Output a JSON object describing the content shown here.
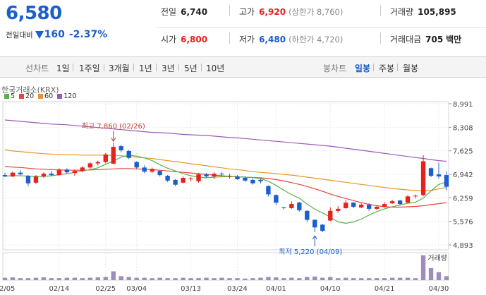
{
  "quote": {
    "price": "6,580",
    "change_label": "전일대비",
    "change_amount": "160",
    "change_pct": "-2.37%",
    "down_color": "#1b5ecd",
    "up_color": "#e8211d"
  },
  "summary": {
    "prev_close_label": "전일",
    "prev_close": "6,740",
    "high_label": "고가",
    "high": "6,920",
    "upper_limit": "(상한가 8,760)",
    "volume_label": "거래량",
    "volume": "105,895",
    "open_label": "시가",
    "open": "6,800",
    "low_label": "저가",
    "low": "6,480",
    "lower_limit": "(하한가 4,720)",
    "amount_label": "거래대금",
    "amount": "705",
    "amount_unit": "백만"
  },
  "toolbar": {
    "line_chart_label": "선차트",
    "periods": [
      "1일",
      "1주일",
      "3개월",
      "1년",
      "3년",
      "5년",
      "10년"
    ],
    "candle_label": "봉차트",
    "candle_periods": [
      "일봉",
      "주봉",
      "월봉"
    ],
    "active_candle": "일봉"
  },
  "exchange_label": "한국거래소(KRX)",
  "legend": [
    {
      "label": "5",
      "color": "#56b348"
    },
    {
      "label": "20",
      "color": "#e8443a"
    },
    {
      "label": "60",
      "color": "#e8962a"
    },
    {
      "label": "120",
      "color": "#9b59b6"
    }
  ],
  "chart_data": {
    "type": "candlestick",
    "y_ticks": [
      "8,991",
      "8,308",
      "7,625",
      "6,942",
      "6,259",
      "5,576",
      "4,893"
    ],
    "y_tick_values": [
      8991,
      8308,
      7625,
      6942,
      6259,
      5576,
      4893
    ],
    "ylim": [
      4893,
      8991
    ],
    "x_ticks": [
      "02/05",
      "02/14",
      "02/25",
      "03/04",
      "03/13",
      "03/24",
      "04/01",
      "04/10",
      "04/21",
      "04/30"
    ],
    "x_tick_index": [
      0,
      7,
      13,
      17,
      24,
      30,
      35,
      42,
      49,
      56
    ],
    "high_annotation": {
      "text": "최고 7,860 (02/26)",
      "index": 14,
      "value": 7860
    },
    "low_annotation": {
      "text": "최저 5,220 (04/09)",
      "index": 40,
      "value": 5220
    },
    "volume_label": "거래량",
    "candles": [
      [
        6920,
        6980,
        6860,
        6880
      ],
      [
        6880,
        7020,
        6860,
        6990
      ],
      [
        6990,
        7060,
        6920,
        6940
      ],
      [
        6900,
        6920,
        6600,
        6680
      ],
      [
        6700,
        6920,
        6660,
        6880
      ],
      [
        6880,
        7000,
        6840,
        6960
      ],
      [
        6960,
        7040,
        6880,
        6920
      ],
      [
        6920,
        7120,
        6900,
        7080
      ],
      [
        7080,
        7120,
        6960,
        7000
      ],
      [
        6980,
        7080,
        6900,
        7040
      ],
      [
        7040,
        7180,
        7000,
        7140
      ],
      [
        7140,
        7300,
        7100,
        7260
      ],
      [
        7260,
        7340,
        7200,
        7300
      ],
      [
        7300,
        7560,
        7260,
        7520
      ],
      [
        7250,
        7860,
        7250,
        7740
      ],
      [
        7760,
        7800,
        7580,
        7640
      ],
      [
        7620,
        7650,
        7380,
        7420
      ],
      [
        7300,
        7320,
        7100,
        7140
      ],
      [
        7140,
        7200,
        6980,
        7020
      ],
      [
        7020,
        7140,
        6980,
        7100
      ],
      [
        7040,
        7060,
        6880,
        6920
      ],
      [
        6900,
        6920,
        6720,
        6760
      ],
      [
        6780,
        6800,
        6600,
        6640
      ],
      [
        6700,
        6880,
        6680,
        6840
      ],
      [
        6800,
        6860,
        6740,
        6820
      ],
      [
        6740,
        6980,
        6700,
        6940
      ],
      [
        6940,
        6980,
        6840,
        6880
      ],
      [
        6880,
        7000,
        6800,
        6960
      ],
      [
        6960,
        7000,
        6900,
        6940
      ],
      [
        6900,
        6960,
        6820,
        6900
      ],
      [
        6880,
        6920,
        6780,
        6800
      ],
      [
        6840,
        6880,
        6720,
        6760
      ],
      [
        6780,
        6820,
        6640,
        6680
      ],
      [
        6780,
        6820,
        6680,
        6740
      ],
      [
        6600,
        6620,
        6300,
        6360
      ],
      [
        6340,
        6360,
        6060,
        6120
      ],
      [
        5980,
        6000,
        5920,
        5960
      ],
      [
        5960,
        6160,
        5940,
        6080
      ],
      [
        6120,
        6140,
        5860,
        5900
      ],
      [
        5880,
        5900,
        5560,
        5620
      ],
      [
        5620,
        5640,
        5260,
        5400
      ],
      [
        5480,
        5500,
        5260,
        5300
      ],
      [
        5600,
        5980,
        5580,
        5880
      ],
      [
        5880,
        6020,
        5820,
        5940
      ],
      [
        5960,
        6200,
        5940,
        6120
      ],
      [
        6120,
        6140,
        5960,
        6000
      ],
      [
        5980,
        6100,
        5960,
        6060
      ],
      [
        6060,
        6100,
        5880,
        5940
      ],
      [
        5940,
        6040,
        5900,
        6000
      ],
      [
        6000,
        6140,
        5980,
        6080
      ],
      [
        6100,
        6200,
        6080,
        6160
      ],
      [
        6180,
        6200,
        6040,
        6080
      ],
      [
        6120,
        6340,
        6100,
        6300
      ],
      [
        6300,
        6360,
        6240,
        6320
      ],
      [
        6340,
        7500,
        6300,
        7320
      ],
      [
        7120,
        7140,
        6860,
        6900
      ],
      [
        6940,
        7280,
        6820,
        6880
      ],
      [
        6920,
        7020,
        6480,
        6580
      ]
    ],
    "volumes": [
      6,
      7,
      5,
      5,
      6,
      7,
      5,
      5,
      6,
      6,
      5,
      6,
      7,
      8,
      22,
      10,
      8,
      6,
      6,
      5,
      6,
      5,
      5,
      6,
      5,
      5,
      6,
      5,
      6,
      5,
      5,
      4,
      5,
      6,
      8,
      7,
      5,
      6,
      5,
      8,
      9,
      6,
      8,
      5,
      6,
      5,
      5,
      5,
      5,
      5,
      6,
      6,
      6,
      5,
      62,
      30,
      20,
      10
    ],
    "ma5": [
      6890,
      6900,
      6900,
      6890,
      6880,
      6880,
      6900,
      6930,
      6960,
      7000,
      7040,
      7080,
      7130,
      7230,
      7330,
      7440,
      7500,
      7470,
      7420,
      7340,
      7220,
      7120,
      7040,
      6960,
      6900,
      6860,
      6840,
      6860,
      6870,
      6880,
      6870,
      6860,
      6850,
      6820,
      6740,
      6620,
      6480,
      6350,
      6250,
      6080,
      5930,
      5820,
      5700,
      5560,
      5520,
      5560,
      5640,
      5760,
      5860,
      5940,
      6000,
      6050,
      6100,
      6130,
      6250,
      6460,
      6650,
      6720
    ],
    "ma20": [
      7170,
      7150,
      7140,
      7120,
      7100,
      7090,
      7080,
      7070,
      7060,
      7060,
      7060,
      7070,
      7080,
      7090,
      7100,
      7110,
      7110,
      7100,
      7090,
      7080,
      7060,
      7040,
      7020,
      7000,
      6980,
      6960,
      6940,
      6920,
      6900,
      6880,
      6870,
      6860,
      6850,
      6840,
      6820,
      6790,
      6750,
      6700,
      6650,
      6590,
      6520,
      6450,
      6370,
      6300,
      6240,
      6180,
      6120,
      6070,
      6030,
      6000,
      5990,
      5990,
      6000,
      6010,
      6030,
      6060,
      6090,
      6120
    ],
    "ma60": [
      7660,
      7620,
      7600,
      7580,
      7560,
      7540,
      7530,
      7520,
      7510,
      7510,
      7500,
      7500,
      7500,
      7500,
      7490,
      7480,
      7460,
      7440,
      7420,
      7400,
      7370,
      7340,
      7310,
      7280,
      7250,
      7220,
      7190,
      7160,
      7130,
      7100,
      7080,
      7050,
      7020,
      7000,
      6980,
      6960,
      6940,
      6920,
      6890,
      6860,
      6830,
      6800,
      6770,
      6740,
      6710,
      6680,
      6650,
      6620,
      6590,
      6560,
      6530,
      6510,
      6490,
      6470,
      6460,
      6470,
      6520,
      6560
    ],
    "ma120": [
      8520,
      8500,
      8480,
      8460,
      8440,
      8420,
      8400,
      8390,
      8380,
      8360,
      8340,
      8320,
      8300,
      8280,
      8260,
      8240,
      8220,
      8200,
      8180,
      8160,
      8150,
      8140,
      8120,
      8100,
      8090,
      8080,
      8070,
      8050,
      8030,
      8010,
      8000,
      7980,
      7960,
      7940,
      7920,
      7900,
      7880,
      7860,
      7840,
      7820,
      7800,
      7780,
      7760,
      7730,
      7700,
      7670,
      7640,
      7610,
      7580,
      7550,
      7520,
      7490,
      7460,
      7430,
      7400,
      7370,
      7340,
      7320
    ]
  }
}
